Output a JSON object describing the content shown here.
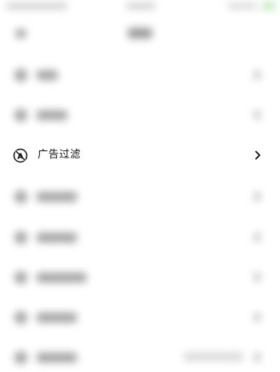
{
  "focused_setting": {
    "label": "广告过滤",
    "icon": "ad-block-icon",
    "icon_letter": "A",
    "chevron_icon": "chevron-right-icon"
  },
  "background": {
    "status_bar_battery_color": "#7ed47a",
    "blurred": true
  }
}
